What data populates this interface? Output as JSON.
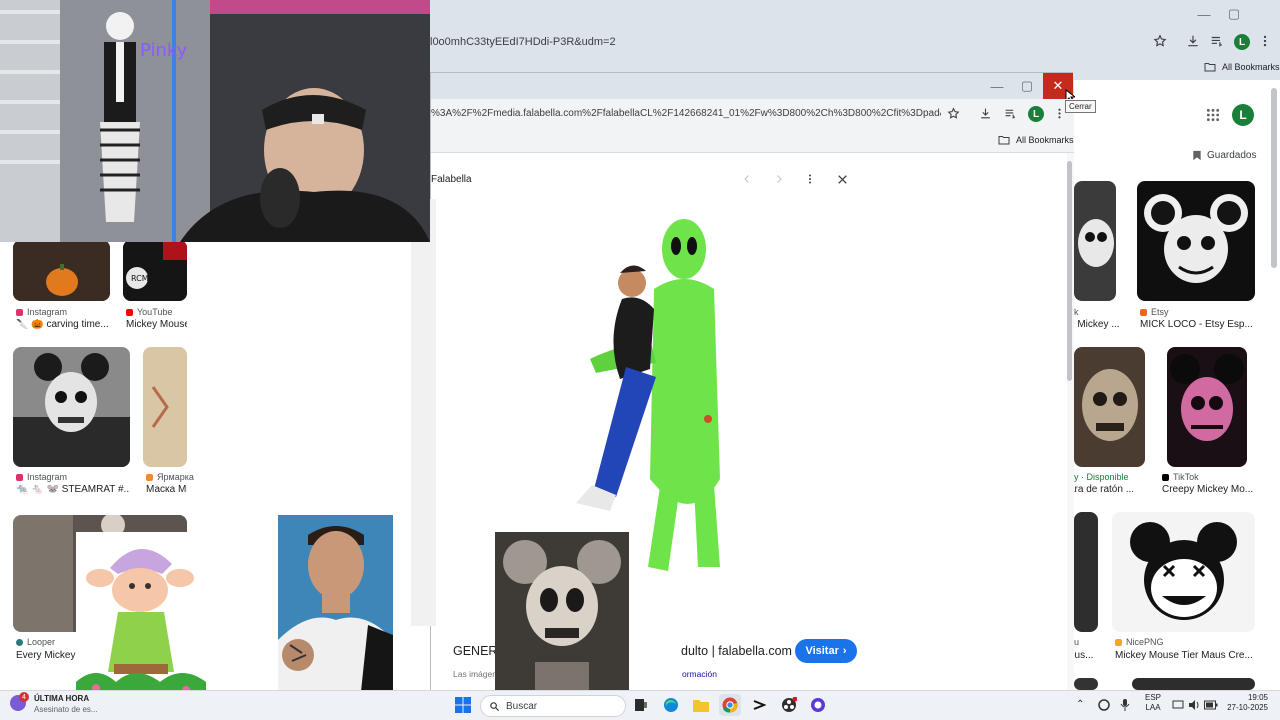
{
  "back_browser": {
    "url": "l0o0mhC33tyEEdI7HDdi-P3R&udm=2",
    "bookmarks_label": "All Bookmarks",
    "profile_initial": "L",
    "window_controls": {
      "minimize": "—",
      "maximize": "▢"
    },
    "saved_label": "Guardados",
    "profile_initial_page": "L"
  },
  "results_left": [
    {
      "source": "Instagram",
      "title": "🔪 🎃 carving time...",
      "color": "#e1306c"
    },
    {
      "source": "YouTube",
      "title": "Mickey Mouse",
      "color": "#ff0000"
    },
    {
      "source": "Instagram",
      "title": "🐀 🐁 🐭 STEAMRAT #...",
      "color": "#e1306c"
    },
    {
      "source": "Ярмарка",
      "title": "Маска Ми",
      "color": "#f58a2b"
    },
    {
      "source": "Looper",
      "title": "Every Mickey",
      "color": "#2b7a78"
    }
  ],
  "results_right": [
    {
      "source": "k",
      "title": "e Mickey ...",
      "color": "#6b6f74"
    },
    {
      "source": "Etsy",
      "title": "MICK LOCO - Etsy Esp...",
      "color": "#f1641e"
    },
    {
      "source": "y · Disponible",
      "title": "ara de ratón ...",
      "color": "#188038"
    },
    {
      "source": "TikTok",
      "title": "Creepy Mickey Mo...",
      "color": "#000000"
    },
    {
      "source": "u",
      "title": "ous...",
      "color": "#6b6f74"
    },
    {
      "source": "NicePNG",
      "title": "Mickey Mouse Tier Maus Cre...",
      "color": "#f5a623"
    }
  ],
  "front_browser": {
    "url": "%3A%2F%2Fmedia.falabella.com%2FfalabellaCL%2F142668241_01%2Fw%3D800%2Ch%3D800%2Cfit%3Dpad&tbnid=bD...",
    "bookmarks_label": "All Bookmarks",
    "profile_initial": "L",
    "close_tooltip": "Cerrar",
    "window_controls": {
      "minimize": "—",
      "maximize": "▢",
      "close": "✕"
    }
  },
  "preview": {
    "site": "Falabella",
    "title": "GENERICO Disfraz",
    "title_suffix": "dulto | falabella.com",
    "visit_label": "Visitar",
    "disclaimer": "Las imágenes pueden estar",
    "disclaimer_suffix": "ormación"
  },
  "taskbar": {
    "news_badge": "4",
    "news_title": "ÚLTIMA HORA",
    "news_subtitle": "Asesinato de es...",
    "search_placeholder": "Buscar",
    "lang_line1": "ESP",
    "lang_line2": "LAA",
    "time": "19:05",
    "date": "27-10-2025"
  },
  "colors": {
    "chrome_frame": "#dde3ea",
    "close_red": "#c42b1c",
    "visit_blue": "#1a73e8",
    "alien_green": "#6fe34a"
  }
}
